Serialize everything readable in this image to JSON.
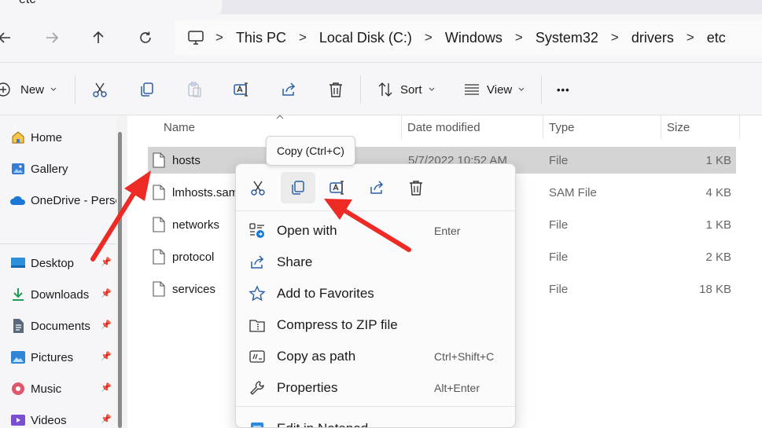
{
  "tab": {
    "title": "etc"
  },
  "nav": {
    "breadcrumbs": [
      "This PC",
      "Local Disk (C:)",
      "Windows",
      "System32",
      "drivers",
      "etc"
    ],
    "separator": ">"
  },
  "toolbar": {
    "new_label": "New",
    "sort_label": "Sort",
    "view_label": "View",
    "more_label": "•••"
  },
  "sidebar": {
    "items": [
      {
        "label": "Home",
        "icon": "home-icon"
      },
      {
        "label": "Gallery",
        "icon": "gallery-icon"
      },
      {
        "label": "OneDrive - Personal",
        "icon": "onedrive-icon"
      },
      {
        "label": "Desktop",
        "icon": "desktop-icon"
      },
      {
        "label": "Downloads",
        "icon": "downloads-icon"
      },
      {
        "label": "Documents",
        "icon": "documents-icon"
      },
      {
        "label": "Pictures",
        "icon": "pictures-icon"
      },
      {
        "label": "Music",
        "icon": "music-icon"
      },
      {
        "label": "Videos",
        "icon": "videos-icon"
      }
    ]
  },
  "columns": {
    "name": "Name",
    "date": "Date modified",
    "type": "Type",
    "size": "Size"
  },
  "files": [
    {
      "name": "hosts",
      "date": "5/7/2022 10:52 AM",
      "type": "File",
      "size": "1 KB"
    },
    {
      "name": "lmhosts.sam",
      "date": "",
      "type": "SAM File",
      "size": "4 KB"
    },
    {
      "name": "networks",
      "date": "",
      "type": "File",
      "size": "1 KB"
    },
    {
      "name": "protocol",
      "date": "",
      "type": "File",
      "size": "2 KB"
    },
    {
      "name": "services",
      "date": "",
      "type": "File",
      "size": "18 KB"
    }
  ],
  "tooltip": {
    "text": "Copy (Ctrl+C)"
  },
  "context_menu": {
    "quick_actions": [
      "cut-icon",
      "copy-icon",
      "rename-icon",
      "share-icon",
      "delete-icon"
    ],
    "items": [
      {
        "label": "Open with",
        "shortcut": "Enter",
        "icon": "open-with-icon"
      },
      {
        "label": "Share",
        "shortcut": "",
        "icon": "share-icon"
      },
      {
        "label": "Add to Favorites",
        "shortcut": "",
        "icon": "star-icon"
      },
      {
        "label": "Compress to ZIP file",
        "shortcut": "",
        "icon": "zip-icon"
      },
      {
        "label": "Copy as path",
        "shortcut": "Ctrl+Shift+C",
        "icon": "copy-path-icon"
      },
      {
        "label": "Properties",
        "shortcut": "Alt+Enter",
        "icon": "wrench-icon"
      },
      {
        "label": "Edit in Notepad",
        "shortcut": "",
        "icon": "notepad-icon"
      }
    ]
  },
  "colors": {
    "annotation_arrow": "#ee2a24",
    "selection": "#d4d4d4",
    "accent": "#0067c0"
  }
}
